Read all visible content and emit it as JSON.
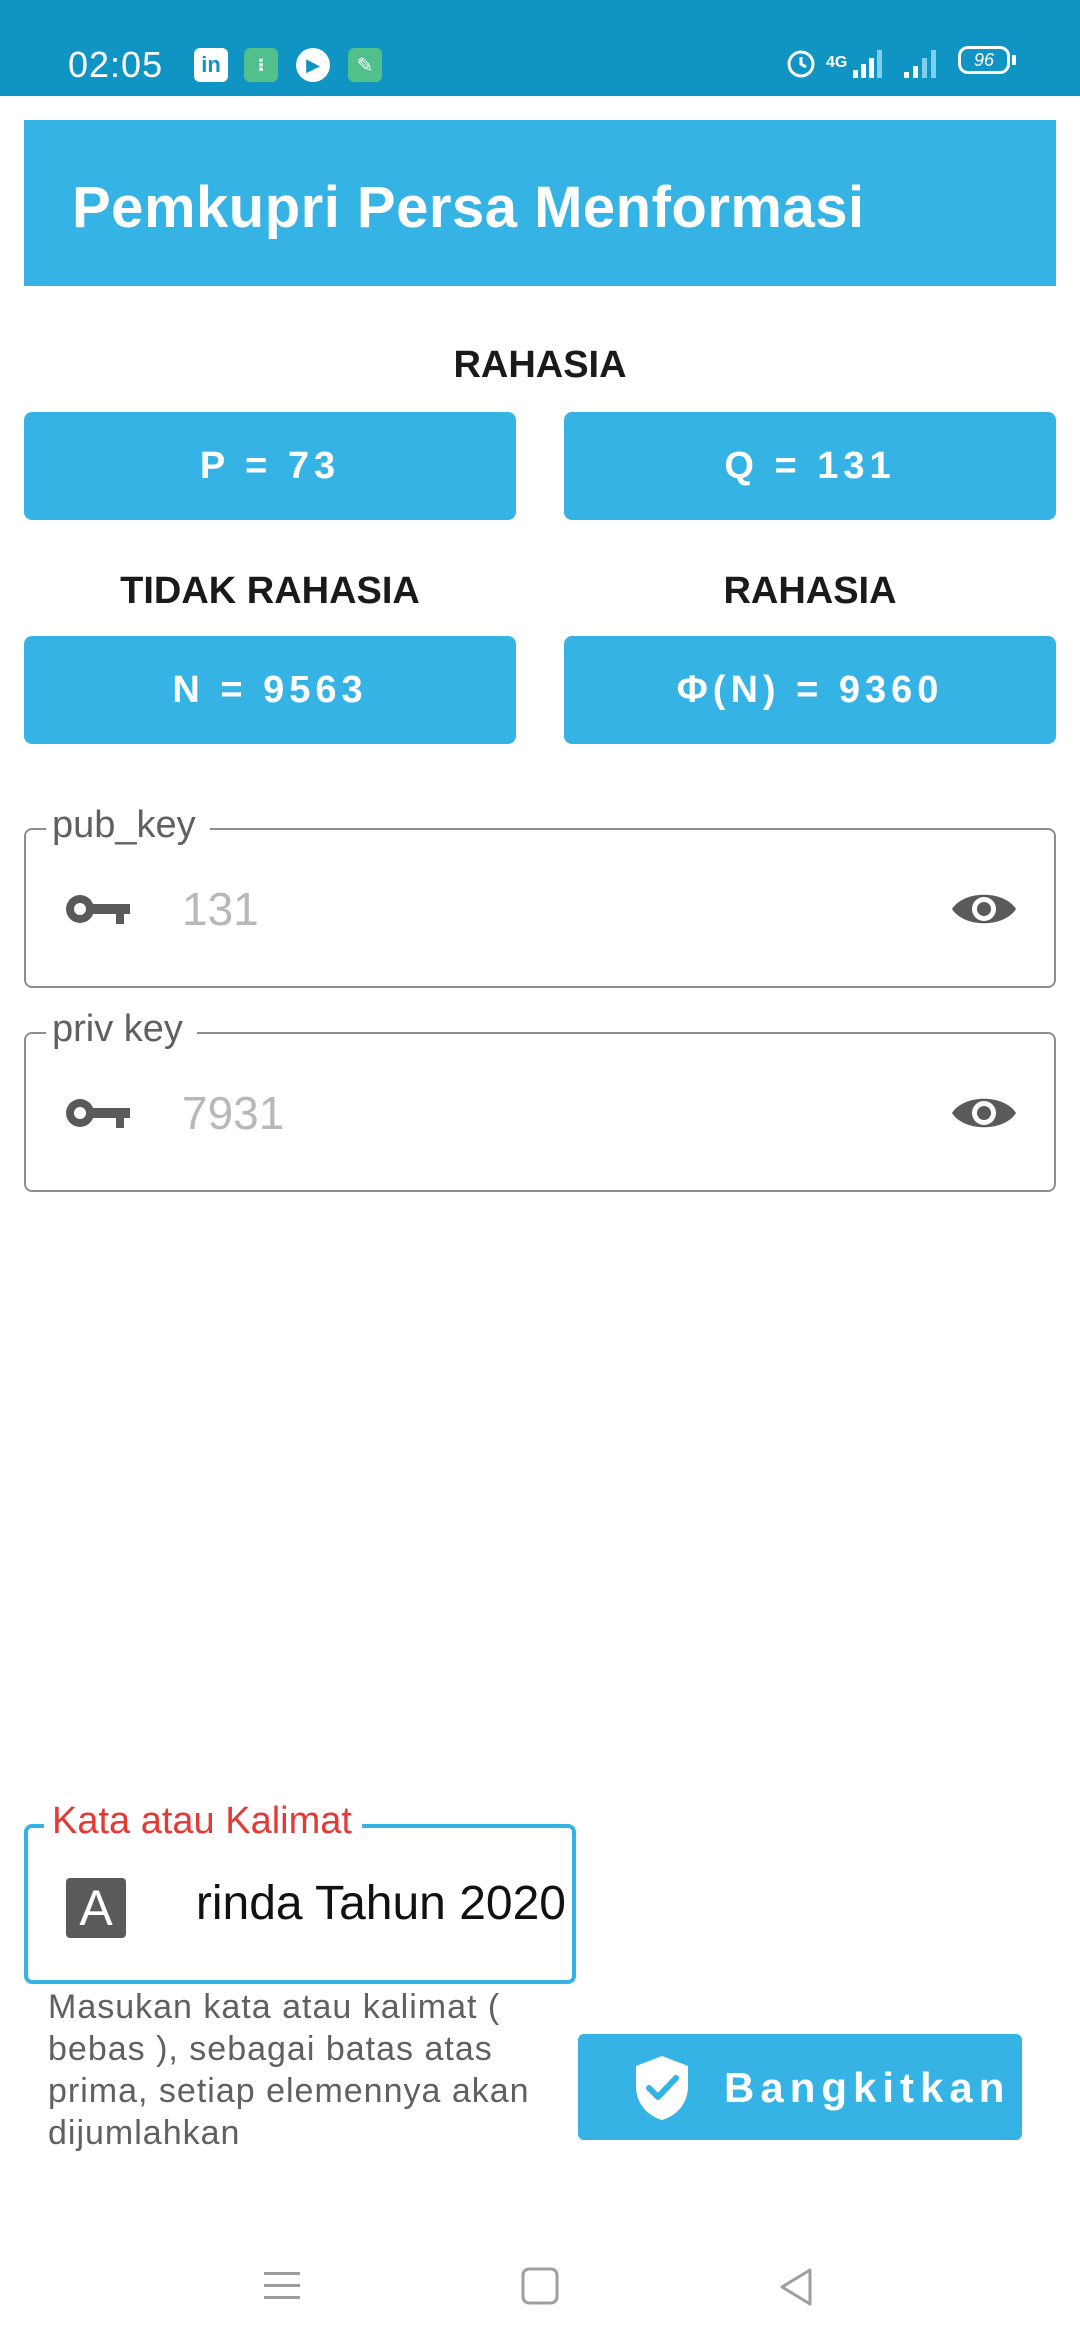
{
  "status_bar": {
    "time": "02:05",
    "network": "4G",
    "battery": "96"
  },
  "app_bar": {
    "title": "Pemkupri Persa Menformasi"
  },
  "secret_label_top": "RAHASIA",
  "p_button": "P = 73",
  "q_button": "Q = 131",
  "not_secret_label": "TIDAK RAHASIA",
  "secret_label_right": "RAHASIA",
  "n_button": "N = 9563",
  "phi_button": "Φ(N) = 9360",
  "pub_key": {
    "label": "pub_key",
    "value": "131"
  },
  "priv_key": {
    "label": "priv key",
    "value": "7931"
  },
  "sentence_input": {
    "label": "Kata atau Kalimat",
    "icon_letter": "A",
    "value": "rinda Tahun 2020"
  },
  "helper_text": "Masukan kata atau kalimat ( bebas ), sebagai batas atas prima, setiap elemennya akan dijumlahkan",
  "generate_button": {
    "label": "Bangkitkan"
  },
  "colors": {
    "accent": "#35b3e5",
    "status_bar": "#0f94c4",
    "error_label": "#e53935"
  }
}
